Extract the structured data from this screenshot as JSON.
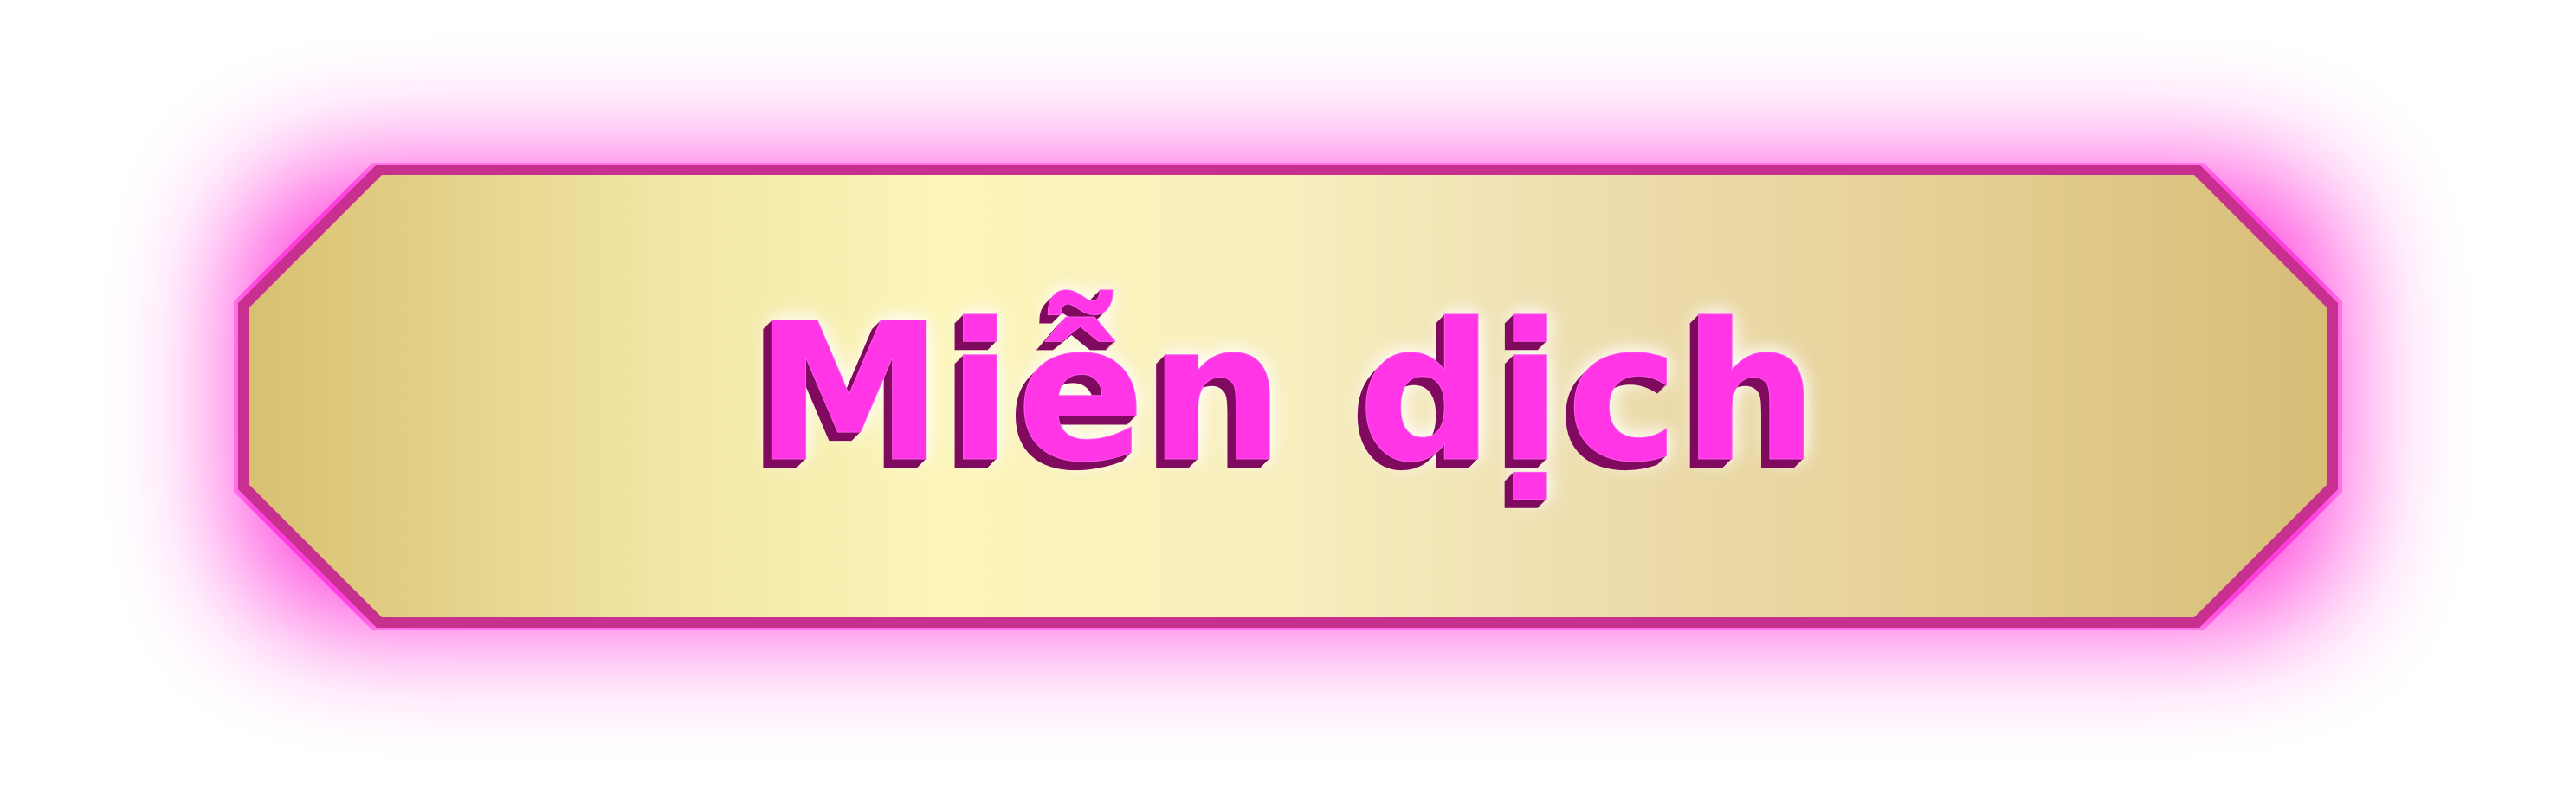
{
  "banner": {
    "title": "Miễn dịch"
  },
  "colors": {
    "glow": "#ff2ed8",
    "border": "#c7308e",
    "banner_left": "#d8c071",
    "banner_center": "#fcf5b8",
    "banner_right": "#d7bd76",
    "title_fill": "#ff35e6",
    "title_depth": "#7f0a5f"
  }
}
